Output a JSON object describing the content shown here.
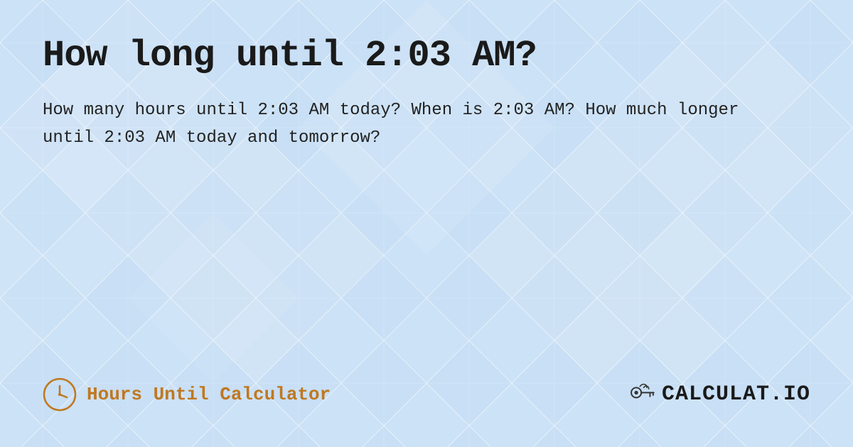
{
  "page": {
    "title": "How long until 2:03 AM?",
    "description": "How many hours until 2:03 AM today? When is 2:03 AM? How much longer until 2:03 AM today and tomorrow?",
    "footer": {
      "calculator_label": "Hours Until Calculator",
      "logo_text": "CALCULAT.IO"
    },
    "background_color": "#c8dff5",
    "accent_color": "#c07820"
  }
}
